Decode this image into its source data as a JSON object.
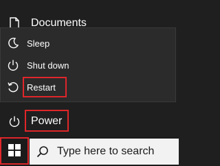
{
  "start_menu": {
    "documents_label": "Documents",
    "power_label": "Power"
  },
  "power_flyout": {
    "items": [
      {
        "label": "Sleep",
        "icon": "moon-icon"
      },
      {
        "label": "Shut down",
        "icon": "power-icon"
      },
      {
        "label": "Restart",
        "icon": "restart-icon"
      }
    ]
  },
  "taskbar": {
    "search_placeholder": "Type here to search"
  },
  "colors": {
    "highlight": "#e0262a",
    "menu_bg": "#1f1f1f",
    "flyout_bg": "#2b2b2b",
    "search_bg": "#f2f2f2"
  }
}
